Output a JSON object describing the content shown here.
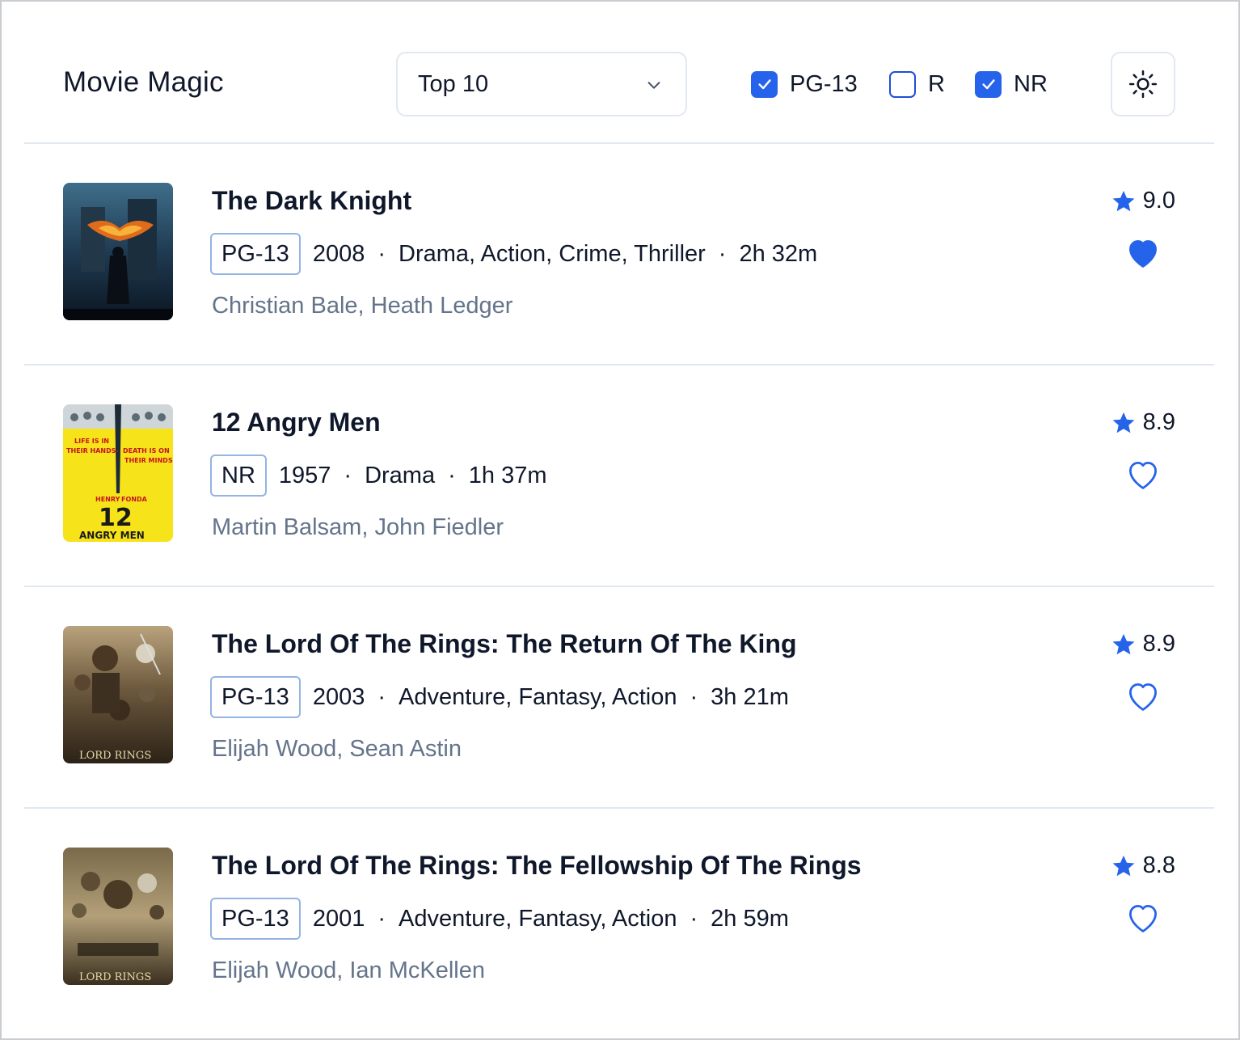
{
  "app": {
    "title": "Movie Magic"
  },
  "header": {
    "list_select": {
      "value": "Top 10"
    },
    "filters": [
      {
        "label": "PG-13",
        "checked": true
      },
      {
        "label": "R",
        "checked": false
      },
      {
        "label": "NR",
        "checked": true
      }
    ],
    "theme_icon": "sun-icon"
  },
  "colors": {
    "accent": "#2563eb",
    "text": "#0f172a",
    "muted": "#64748b",
    "divider": "#e2e8f0"
  },
  "movies": [
    {
      "title": "The Dark Knight",
      "rating_badge": "PG-13",
      "year": "2008",
      "genres": "Drama, Action, Crime, Thriller",
      "runtime": "2h 32m",
      "cast": "Christian Bale, Heath Ledger",
      "score": "9.0",
      "favorite": true
    },
    {
      "title": "12 Angry Men",
      "rating_badge": "NR",
      "year": "1957",
      "genres": "Drama",
      "runtime": "1h 37m",
      "cast": "Martin Balsam, John Fiedler",
      "score": "8.9",
      "favorite": false
    },
    {
      "title": "The Lord Of The Rings: The Return Of The King",
      "rating_badge": "PG-13",
      "year": "2003",
      "genres": "Adventure, Fantasy, Action",
      "runtime": "3h 21m",
      "cast": "Elijah Wood, Sean Astin",
      "score": "8.9",
      "favorite": false
    },
    {
      "title": "The Lord Of The Rings: The Fellowship Of The Rings",
      "rating_badge": "PG-13",
      "year": "2001",
      "genres": "Adventure, Fantasy, Action",
      "runtime": "2h 59m",
      "cast": "Elijah Wood, Ian McKellen",
      "score": "8.8",
      "favorite": false
    }
  ],
  "separator": "·"
}
